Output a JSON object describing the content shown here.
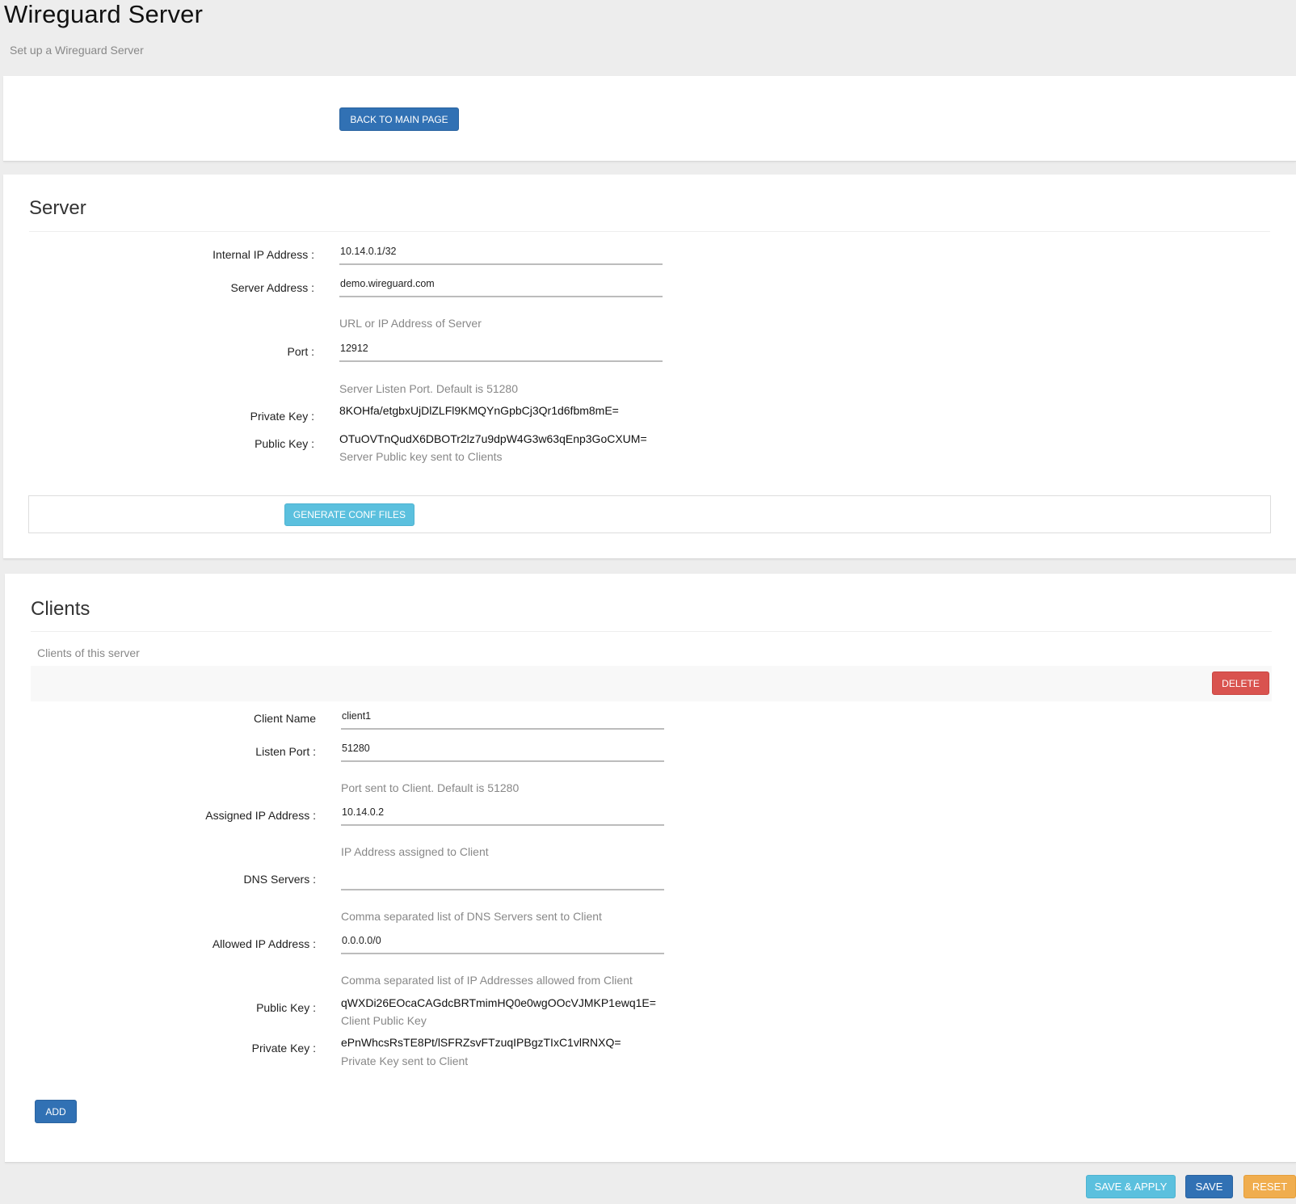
{
  "header": {
    "title": "Wireguard Server",
    "subtitle": "Set up a Wireguard Server"
  },
  "top_panel": {
    "back_button": "Back to Main Page"
  },
  "server": {
    "title": "Server",
    "internal_ip": {
      "label": "Internal IP Address :",
      "value": "10.14.0.1/32"
    },
    "server_address": {
      "label": "Server Address :",
      "value": "demo.wireguard.com",
      "help": "URL or IP Address of Server"
    },
    "port": {
      "label": "Port :",
      "value": "12912",
      "help": "Server Listen Port. Default is 51280"
    },
    "private_key": {
      "label": "Private Key :",
      "value": "8KOHfa/etgbxUjDlZLFl9KMQYnGpbCj3Qr1d6fbm8mE="
    },
    "public_key": {
      "label": "Public Key :",
      "value": "OTuOVTnQudX6DBOTr2lz7u9dpW4G3w63qEnp3GoCXUM=",
      "help": "Server Public key sent to Clients"
    },
    "generate_button": "Generate Conf Files"
  },
  "clients": {
    "title": "Clients",
    "description": "Clients of this server",
    "delete_button": "Delete",
    "client_name": {
      "label": "Client Name",
      "value": "client1"
    },
    "listen_port": {
      "label": "Listen Port :",
      "value": "51280",
      "help": "Port sent to Client. Default is 51280"
    },
    "assigned_ip": {
      "label": "Assigned IP Address :",
      "value": "10.14.0.2",
      "help": "IP Address assigned to Client"
    },
    "dns_servers": {
      "label": "DNS Servers :",
      "value": "",
      "help": "Comma separated list of DNS Servers sent to Client"
    },
    "allowed_ip": {
      "label": "Allowed IP Address :",
      "value": "0.0.0.0/0",
      "help": "Comma separated list of IP Addresses allowed from Client"
    },
    "public_key": {
      "label": "Public Key :",
      "value": "qWXDi26EOcaCAGdcBRTmimHQ0e0wgOOcVJMKP1ewq1E=",
      "help": "Client Public Key"
    },
    "private_key": {
      "label": "Private Key :",
      "value": "ePnWhcsRsTE8Pt/lSFRZsvFTzuqIPBgzTIxC1vlRNXQ=",
      "help": "Private Key sent to Client"
    },
    "add_button": "Add"
  },
  "footer": {
    "save_apply_button": "Save & Apply",
    "save_button": "Save",
    "reset_button": "Reset"
  },
  "colors": {
    "primary": "#3171b4",
    "info": "#5bc0de",
    "danger": "#d9534f",
    "warning": "#f0ad4e"
  }
}
